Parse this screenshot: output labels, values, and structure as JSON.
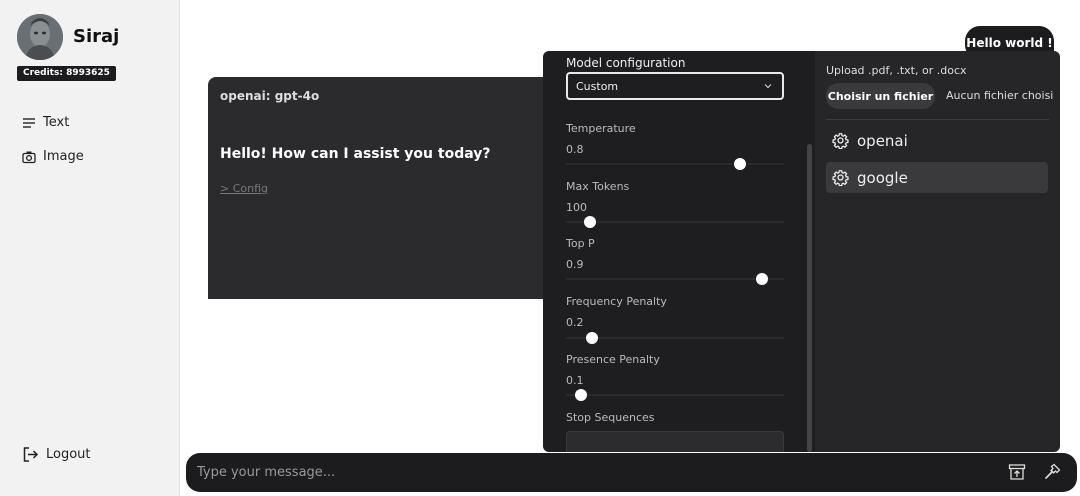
{
  "user": {
    "name": "Siraj",
    "credits": "Credits: 8993625"
  },
  "nav": {
    "items": [
      {
        "label": "Text",
        "icon": "menu-icon"
      },
      {
        "label": "Image",
        "icon": "camera-icon"
      }
    ],
    "logout": "Logout"
  },
  "chat": {
    "user_message": "Hello world !",
    "bot": {
      "model": "openai: gpt-4o",
      "message": "Hello! How can I assist you today?",
      "config_link": "> Config"
    }
  },
  "config": {
    "title": "Model configuration",
    "selected": "Custom",
    "params": [
      {
        "label": "Temperature",
        "value": "0.8",
        "level": 0.8
      },
      {
        "label": "Max Tokens",
        "value": "100",
        "level": 0.11
      },
      {
        "label": "Top P",
        "value": "0.9",
        "level": 0.9
      },
      {
        "label": "Frequency Penalty",
        "value": "0.2",
        "level": 0.12
      },
      {
        "label": "Presence Penalty",
        "value": "0.1",
        "level": 0.07
      }
    ],
    "stop_sequences_label": "Stop Sequences"
  },
  "files": {
    "upload_label": "Upload .pdf, .txt, or .docx",
    "choose_button": "Choisir un fichier",
    "no_file": "Aucun fichier choisi"
  },
  "providers": [
    {
      "label": "openai",
      "active": false
    },
    {
      "label": "google",
      "active": true
    }
  ],
  "input": {
    "placeholder": "Type your message..."
  },
  "colors": {
    "dark": "#1c1c1e",
    "panel": "#262628",
    "sidebar": "#f2f2f2"
  }
}
